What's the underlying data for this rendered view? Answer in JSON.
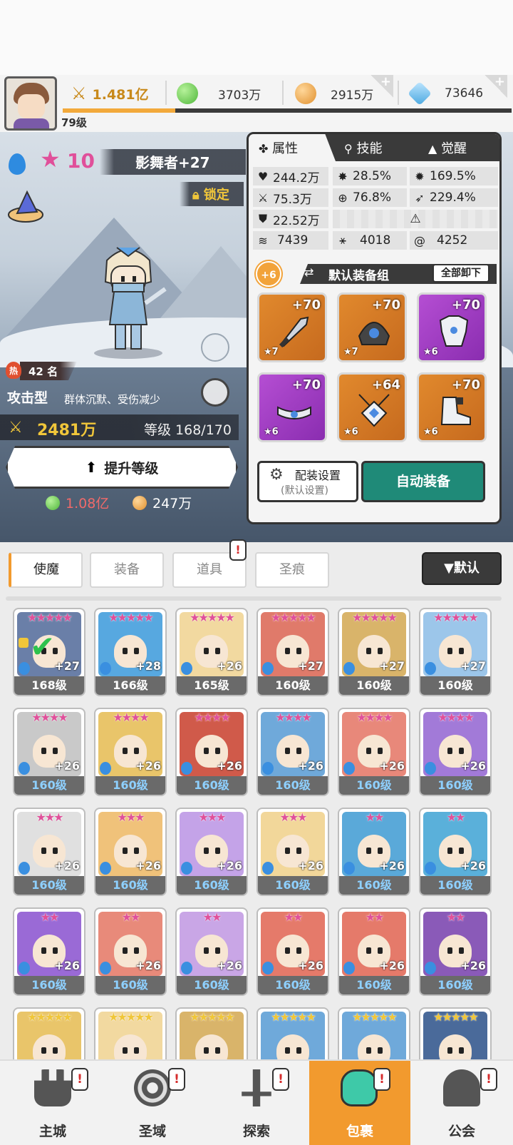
{
  "header": {
    "player_level": "79级",
    "power": "1.481亿",
    "green_currency": "3703万",
    "gold_currency": "2915万",
    "gems": "73646",
    "xp_progress": 0.25
  },
  "hero": {
    "stars": "10",
    "name": "影舞者+27",
    "lock_label": "锁定",
    "rank": "42 名",
    "hot_badge": "热",
    "type": "攻击型",
    "type_desc": "群体沉默、受伤减少",
    "power": "2481万",
    "level": "等级 168/170",
    "upgrade_label": "提升等级",
    "cost_green": "1.08亿",
    "cost_gold": "247万"
  },
  "attr_panel": {
    "tabs": [
      "属性",
      "技能",
      "觉醒"
    ],
    "stats": [
      {
        "icon": "heart-icon",
        "value": "244.2万"
      },
      {
        "icon": "crit-icon",
        "value": "28.5%"
      },
      {
        "icon": "crit-dmg-icon",
        "value": "169.5%"
      },
      {
        "icon": "attack-icon",
        "value": "75.3万"
      },
      {
        "icon": "accuracy-icon",
        "value": "76.8%"
      },
      {
        "icon": "speed-icon",
        "value": "229.4%"
      },
      {
        "icon": "defense-icon",
        "value": "22.52万"
      },
      {
        "icon": "wind-icon",
        "value": "7439"
      },
      {
        "icon": "dodge-icon",
        "value": "4018"
      },
      {
        "icon": "swirl-icon",
        "value": "4252"
      }
    ],
    "gear_plus": "+6",
    "gear_set": "默认装备组",
    "unequip_all": "全部卸下",
    "slots": [
      {
        "plus": "+70",
        "tier": "★7",
        "rarity": "orange"
      },
      {
        "plus": "+70",
        "tier": "★7",
        "rarity": "orange"
      },
      {
        "plus": "+70",
        "tier": "★6",
        "rarity": "purple"
      },
      {
        "plus": "+70",
        "tier": "★6",
        "rarity": "purple"
      },
      {
        "plus": "+64",
        "tier": "★6",
        "rarity": "orange"
      },
      {
        "plus": "+70",
        "tier": "★6",
        "rarity": "orange"
      }
    ],
    "config_label": "配装设置",
    "config_sub": "(默认设置)",
    "auto_equip": "自动装备"
  },
  "filters": {
    "tabs": [
      "使魔",
      "装备",
      "道具",
      "圣痕"
    ],
    "sort": "▼默认",
    "alert": "!"
  },
  "heroes": [
    {
      "stars": "★★★★★",
      "plus": "+27",
      "level": "168级",
      "color": "#6a7fa8"
    },
    {
      "stars": "★★★★★",
      "plus": "+28",
      "level": "166级",
      "color": "#57a8e0"
    },
    {
      "stars": "★★★★★",
      "plus": "+26",
      "level": "165级",
      "color": "#f2d9a0"
    },
    {
      "stars": "★★★★★",
      "plus": "+27",
      "level": "160级",
      "color": "#e07a6a"
    },
    {
      "stars": "★★★★★",
      "plus": "+27",
      "level": "160级",
      "color": "#d9b46a"
    },
    {
      "stars": "★★★★★",
      "plus": "+27",
      "level": "160级",
      "color": "#9cc6ea"
    },
    {
      "stars": "★★★★",
      "plus": "+26",
      "level": "160级",
      "color": "#c9c9c9"
    },
    {
      "stars": "★★★★",
      "plus": "+26",
      "level": "160级",
      "color": "#e9c56a"
    },
    {
      "stars": "★★★★",
      "plus": "+26",
      "level": "160级",
      "color": "#d05a4a"
    },
    {
      "stars": "★★★★",
      "plus": "+26",
      "level": "160级",
      "color": "#6fa9da"
    },
    {
      "stars": "★★★★",
      "plus": "+26",
      "level": "160级",
      "color": "#e8887a"
    },
    {
      "stars": "★★★★",
      "plus": "+26",
      "level": "160级",
      "color": "#a27ad8"
    },
    {
      "stars": "★★★",
      "plus": "+26",
      "level": "160级",
      "color": "#e0e0e0"
    },
    {
      "stars": "★★★",
      "plus": "+26",
      "level": "160级",
      "color": "#f0c27a"
    },
    {
      "stars": "★★★",
      "plus": "+26",
      "level": "160级",
      "color": "#c4a3e8"
    },
    {
      "stars": "★★★",
      "plus": "+26",
      "level": "160级",
      "color": "#f2d79a"
    },
    {
      "stars": "★★",
      "plus": "+26",
      "level": "160级",
      "color": "#5aa9d9"
    },
    {
      "stars": "★★",
      "plus": "+26",
      "level": "160级",
      "color": "#5ab0da"
    },
    {
      "stars": "★★",
      "plus": "+26",
      "level": "160级",
      "color": "#9a6ad6"
    },
    {
      "stars": "★★",
      "plus": "+26",
      "level": "160级",
      "color": "#e88a7a"
    },
    {
      "stars": "★★",
      "plus": "+26",
      "level": "160级",
      "color": "#c9a6e6"
    },
    {
      "stars": "★★",
      "plus": "+26",
      "level": "160级",
      "color": "#e57a6a"
    },
    {
      "stars": "★★",
      "plus": "+26",
      "level": "160级",
      "color": "#e57a6a"
    },
    {
      "stars": "★★",
      "plus": "+26",
      "level": "160级",
      "color": "#8a5ab8"
    },
    {
      "stars": "★★★★★",
      "plus": "",
      "level": "",
      "color": "#e9c56a"
    },
    {
      "stars": "★★★★★",
      "plus": "",
      "level": "",
      "color": "#f2d9a0"
    },
    {
      "stars": "★★★★★",
      "plus": "",
      "level": "",
      "color": "#d9b46a"
    },
    {
      "stars": "★★★★★",
      "plus": "",
      "level": "",
      "color": "#6fa9da"
    },
    {
      "stars": "★★★★★",
      "plus": "",
      "level": "",
      "color": "#6fa9da"
    },
    {
      "stars": "★★★★★",
      "plus": "",
      "level": "",
      "color": "#4a6a9a"
    }
  ],
  "nav": [
    {
      "label": "主城",
      "icon": "castle-icon",
      "alert": "!"
    },
    {
      "label": "圣域",
      "icon": "vortex-icon",
      "alert": "!"
    },
    {
      "label": "探索",
      "icon": "sword-icon",
      "alert": "!"
    },
    {
      "label": "包裹",
      "icon": "bag-icon",
      "alert": "!"
    },
    {
      "label": "公会",
      "icon": "guild-icon",
      "alert": "!"
    }
  ]
}
